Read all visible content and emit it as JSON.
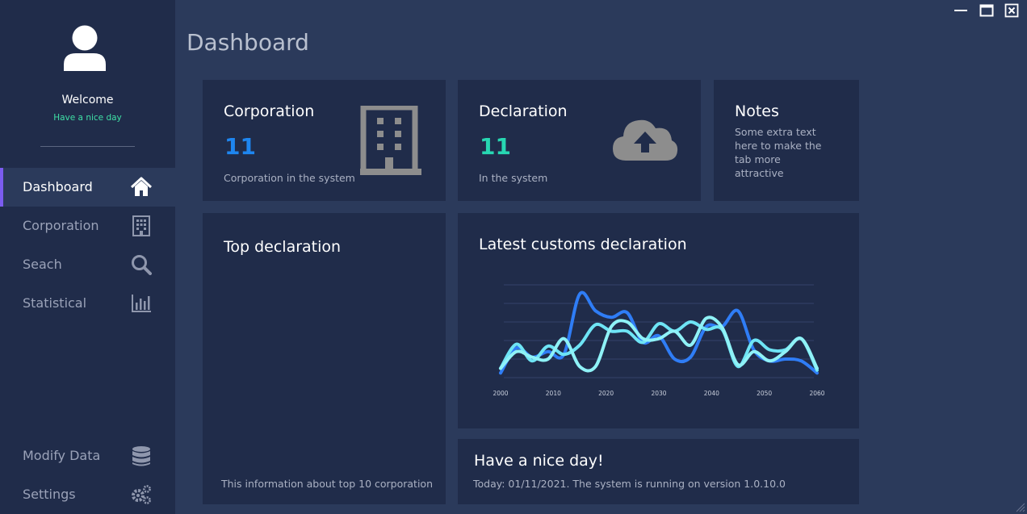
{
  "window": {
    "controls": [
      "minimize-icon",
      "maximize-icon",
      "close-icon"
    ]
  },
  "sidebar": {
    "welcome": "Welcome",
    "greeting": "Have a nice day",
    "items": [
      {
        "label": "Dashboard",
        "icon": "home-icon",
        "active": true
      },
      {
        "label": "Corporation",
        "icon": "building-icon",
        "active": false
      },
      {
        "label": "Seach",
        "icon": "search-icon",
        "active": false
      },
      {
        "label": "Statistical",
        "icon": "bar-chart-icon",
        "active": false
      }
    ],
    "bottom_items": [
      {
        "label": "Modify Data",
        "icon": "database-icon"
      },
      {
        "label": "Settings",
        "icon": "gears-icon"
      }
    ]
  },
  "page": {
    "title": "Dashboard"
  },
  "cards": {
    "corporation": {
      "title": "Corporation",
      "count": "11",
      "subtitle": "Corporation in the system",
      "icon": "building-icon",
      "count_color": "#1e86f0"
    },
    "declaration": {
      "title": "Declaration",
      "count": "11",
      "subtitle": "In the system",
      "icon": "cloud-upload-icon",
      "count_color": "#27d7b2"
    },
    "notes": {
      "title": "Notes",
      "text": "Some extra text here to make the tab more attractive"
    },
    "top_declaration": {
      "title": "Top declaration",
      "footer": "This information about top 10 corporation"
    },
    "latest": {
      "title": "Latest customs declaration"
    },
    "nice_day": {
      "title": "Have a nice day!",
      "text": "Today: 01/11/2021. The system is running on version 1.0.10.0"
    }
  },
  "colors": {
    "accent": "#7b5cf0",
    "background": "#2b3a5b",
    "panel": "#202c4a",
    "greeting": "#3fe0a6"
  },
  "chart_data": {
    "type": "line",
    "x_ticks": [
      "2000",
      "2010",
      "2020",
      "2030",
      "2040",
      "2050",
      "2060"
    ],
    "x": [
      2000,
      2003,
      2006,
      2009,
      2012,
      2015,
      2018,
      2021,
      2024,
      2027,
      2030,
      2033,
      2036,
      2039,
      2042,
      2045,
      2048,
      2051,
      2054,
      2057,
      2060
    ],
    "grid": true,
    "legend": "none",
    "series": [
      {
        "color": "#2f7df6",
        "values": [
          0.05,
          0.32,
          0.22,
          0.28,
          0.25,
          0.9,
          0.72,
          0.65,
          0.7,
          0.38,
          0.45,
          0.2,
          0.22,
          0.55,
          0.55,
          0.72,
          0.3,
          0.18,
          0.2,
          0.18,
          0.05
        ]
      },
      {
        "color": "#6ee4f5",
        "values": [
          0.1,
          0.36,
          0.18,
          0.34,
          0.25,
          0.35,
          0.57,
          0.5,
          0.5,
          0.38,
          0.58,
          0.5,
          0.6,
          0.52,
          0.52,
          0.12,
          0.4,
          0.3,
          0.3,
          0.42,
          0.08
        ]
      },
      {
        "color": "#8ff2f7",
        "values": [
          0.1,
          0.28,
          0.22,
          0.2,
          0.42,
          0.12,
          0.12,
          0.55,
          0.6,
          0.42,
          0.42,
          0.5,
          0.35,
          0.64,
          0.54,
          0.14,
          0.28,
          0.18,
          0.28,
          0.42,
          0.1
        ]
      }
    ]
  }
}
